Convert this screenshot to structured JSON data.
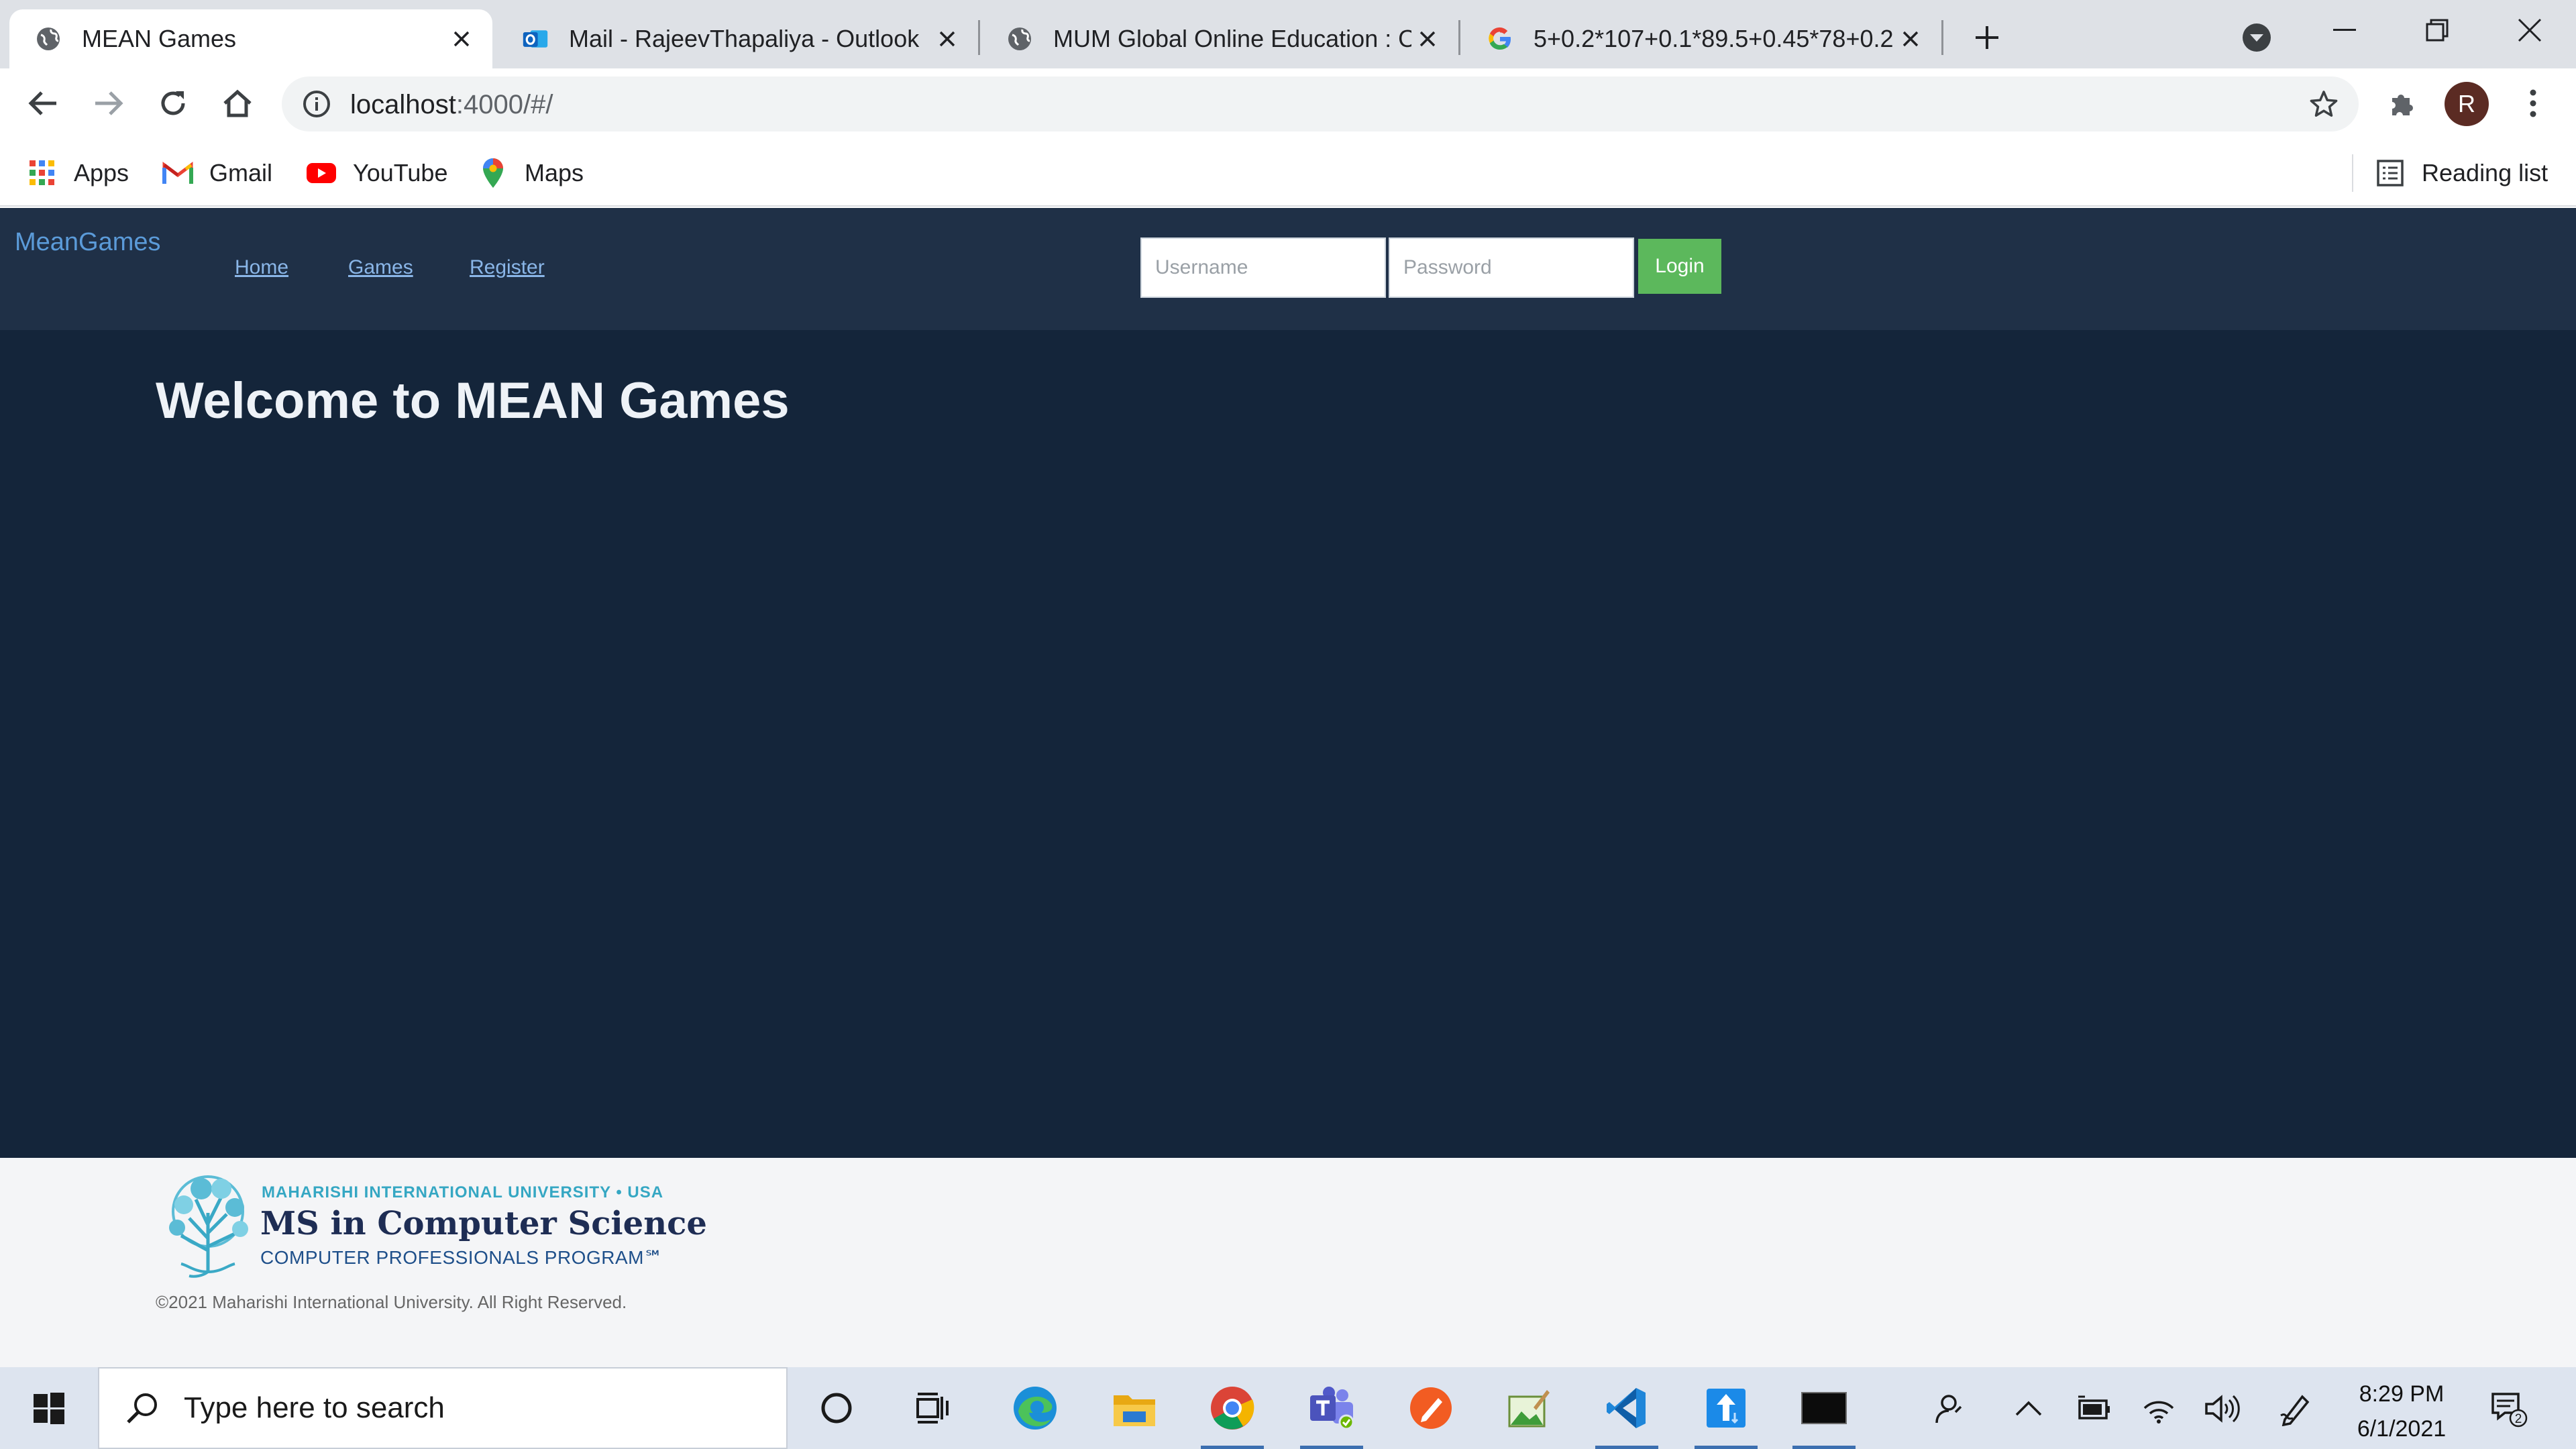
{
  "browser": {
    "tabs": [
      {
        "title": "MEAN Games",
        "active": true,
        "favicon": "globe-icon"
      },
      {
        "title": "Mail - RajeevThapaliya - Outlook",
        "active": false,
        "favicon": "outlook-icon"
      },
      {
        "title": "MUM Global Online Education : O",
        "active": false,
        "favicon": "globe-icon"
      },
      {
        "title": "5+0.2*107+0.1*89.5+0.45*78+0.2",
        "active": false,
        "favicon": "google-icon"
      }
    ],
    "url_host": "localhost",
    "url_path": ":4000/#/",
    "profile_initial": "R",
    "bookmarks": [
      {
        "label": "Apps",
        "icon": "apps-grid-icon"
      },
      {
        "label": "Gmail",
        "icon": "gmail-icon"
      },
      {
        "label": "YouTube",
        "icon": "youtube-icon"
      },
      {
        "label": "Maps",
        "icon": "maps-icon"
      }
    ],
    "reading_list": "Reading list"
  },
  "site": {
    "brand": "MeanGames",
    "nav": [
      "Home",
      "Games",
      "Register"
    ],
    "username_placeholder": "Username",
    "password_placeholder": "Password",
    "login_label": "Login",
    "welcome": "Welcome to MEAN Games"
  },
  "footer": {
    "logo_line1": "MAHARISHI INTERNATIONAL UNIVERSITY • USA",
    "logo_line2": "MS in Computer Science",
    "logo_line3": "COMPUTER PROFESSIONALS PROGRAM℠",
    "copyright": "©2021 Maharishi International University. All Right Reserved."
  },
  "taskbar": {
    "search_placeholder": "Type here to search",
    "time": "8:29 PM",
    "date": "6/1/2021",
    "notification_count": "2"
  },
  "colors": {
    "page_bg": "#14253a",
    "header_bg": "#1f3047",
    "brand_link": "#5b9bd9",
    "login_button": "#5cb85c",
    "footer_bg": "#f4f5f7"
  }
}
